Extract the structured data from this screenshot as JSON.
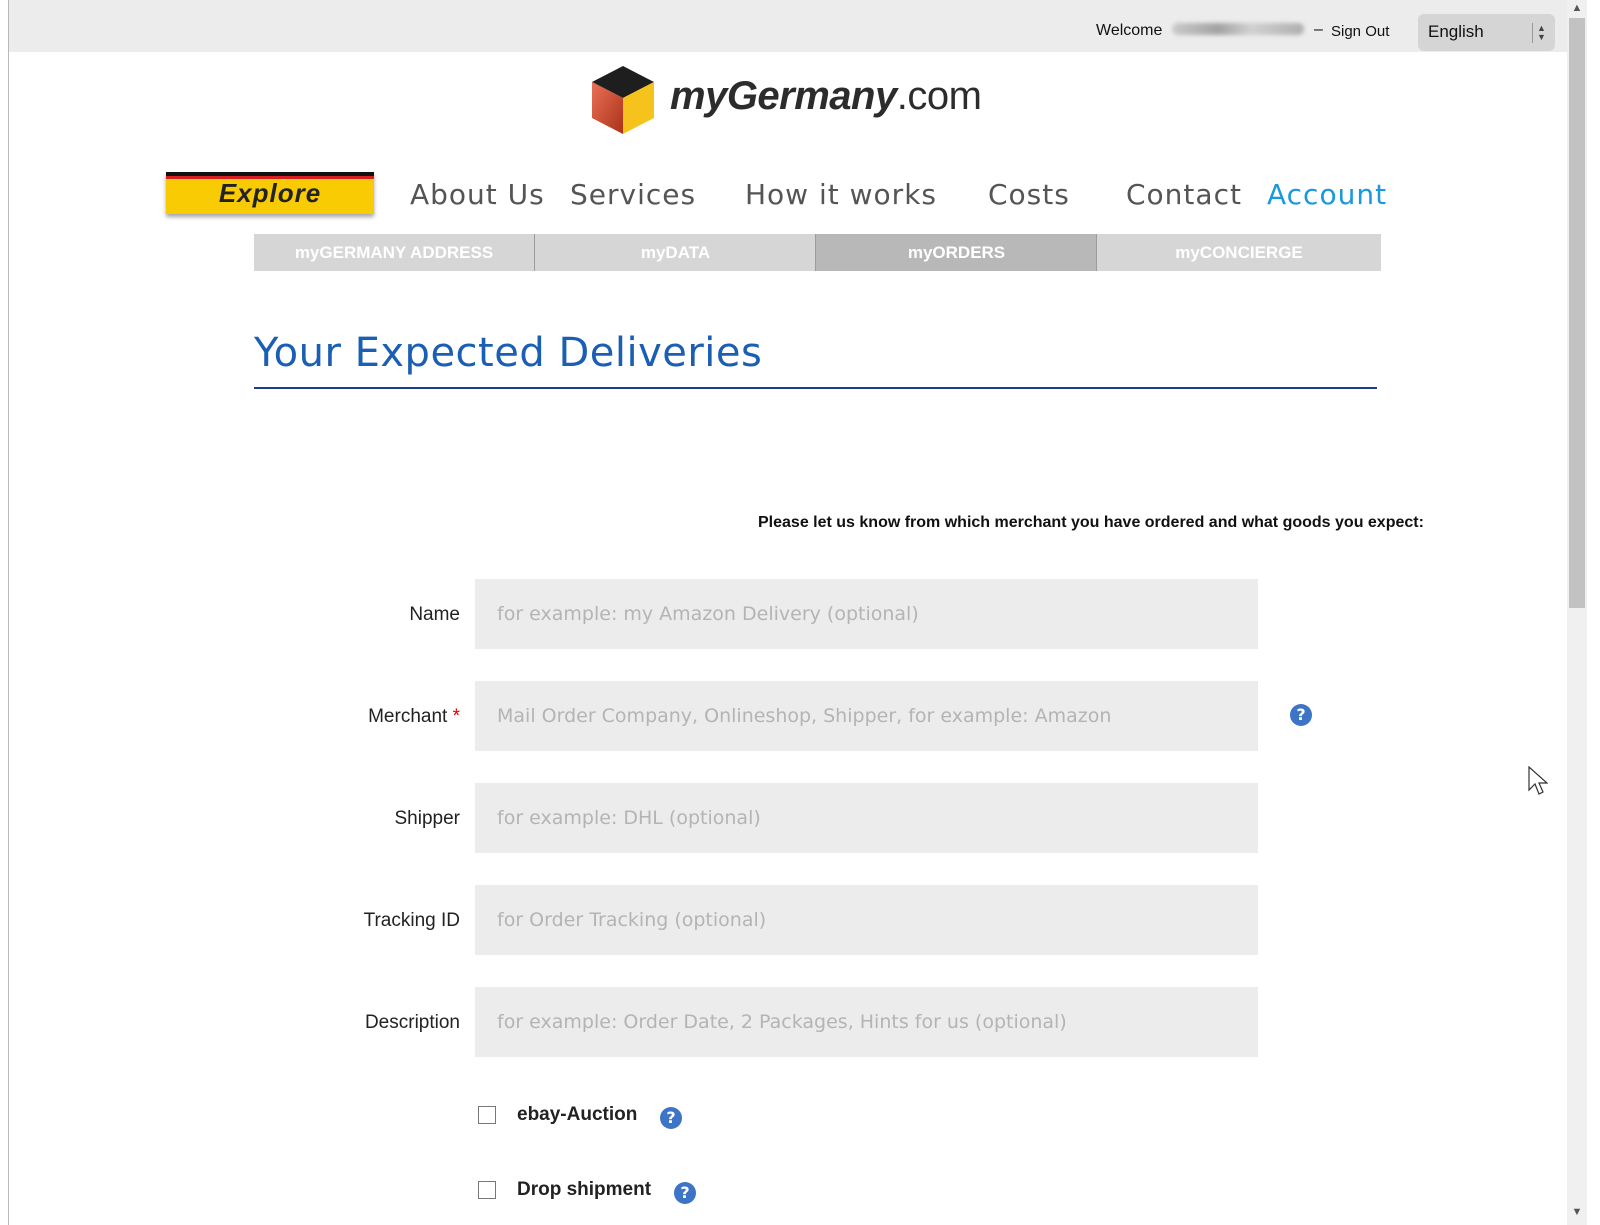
{
  "header": {
    "welcome_label": "Welcome",
    "separator": "–",
    "signout_label": "Sign Out",
    "language": "English"
  },
  "logo": {
    "brand": "myGermany",
    "tld": ".com"
  },
  "nav": {
    "explore_label": "Explore",
    "items": [
      {
        "label": "About Us"
      },
      {
        "label": "Services"
      },
      {
        "label": "How it works"
      },
      {
        "label": "Costs"
      },
      {
        "label": "Contact"
      },
      {
        "label": "Account",
        "active": true
      }
    ]
  },
  "subnav": {
    "tabs": [
      {
        "label": "myGERMANY ADDRESS"
      },
      {
        "label": "myDATA"
      },
      {
        "label": "myORDERS",
        "active": true
      },
      {
        "label": "myCONCIERGE"
      }
    ]
  },
  "page": {
    "title": "Your Expected Deliveries",
    "intro": "Please let us know from which merchant you have ordered and what goods you expect:"
  },
  "form": {
    "name": {
      "label": "Name",
      "placeholder": "for example: my Amazon Delivery (optional)",
      "value": ""
    },
    "merchant": {
      "label": "Merchant",
      "required_mark": "*",
      "placeholder": "Mail Order Company, Onlineshop, Shipper, for example: Amazon",
      "value": ""
    },
    "shipper": {
      "label": "Shipper",
      "placeholder": "for example: DHL (optional)",
      "value": ""
    },
    "tracking": {
      "label": "Tracking ID",
      "placeholder": "for Order Tracking (optional)",
      "value": ""
    },
    "description": {
      "label": "Description",
      "placeholder": "for example: Order Date, 2 Packages, Hints for us (optional)",
      "value": ""
    },
    "ebay": {
      "label": "ebay-Auction",
      "checked": false
    },
    "drop": {
      "label": "Drop shipment",
      "checked": false
    }
  },
  "icons": {
    "help": "?",
    "scroll_up": "▲",
    "scroll_down": "▼"
  },
  "colors": {
    "title_blue": "#1a5fb4",
    "account_blue": "#1b99dd",
    "explore_yellow": "#f9cb02",
    "help_blue": "#3d74c5"
  }
}
